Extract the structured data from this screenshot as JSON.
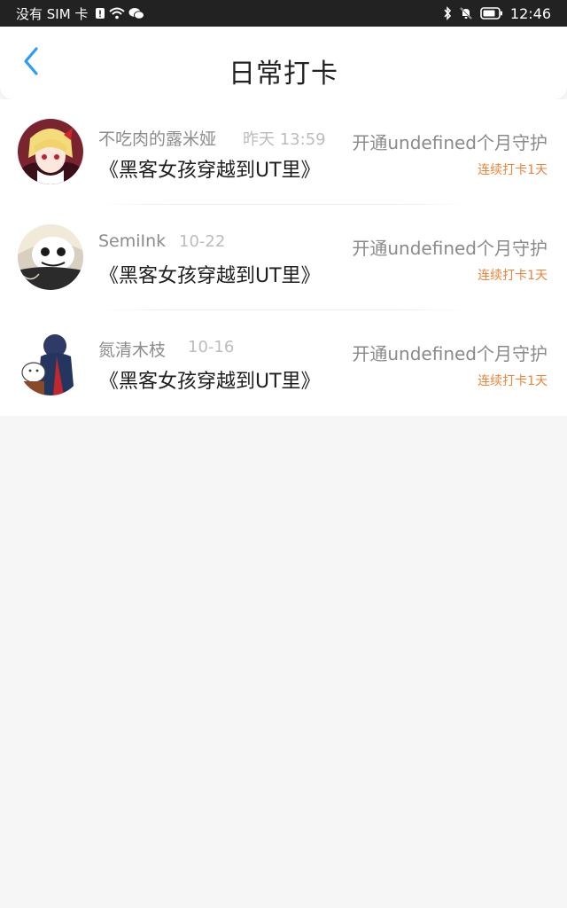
{
  "status_bar": {
    "carrier": "没有 SIM 卡",
    "time": "12:46"
  },
  "header": {
    "title": "日常打卡"
  },
  "entries": [
    {
      "username": "不吃肉的露米娅",
      "time": "昨天 13:59",
      "book": "《黑客女孩穿越到UT里》",
      "guard_text": "开通undefined个月守护",
      "streak": "连续打卡1天"
    },
    {
      "username": "SemiInk",
      "time": "10-22",
      "book": "《黑客女孩穿越到UT里》",
      "guard_text": "开通undefined个月守护",
      "streak": "连续打卡1天"
    },
    {
      "username": "氮清木枝",
      "time": "10-16",
      "book": "《黑客女孩穿越到UT里》",
      "guard_text": "开通undefined个月守护",
      "streak": "连续打卡1天"
    }
  ],
  "colors": {
    "accent_blue": "#2a9df4",
    "streak_orange": "#ef8237",
    "background": "#f7f6f6"
  }
}
